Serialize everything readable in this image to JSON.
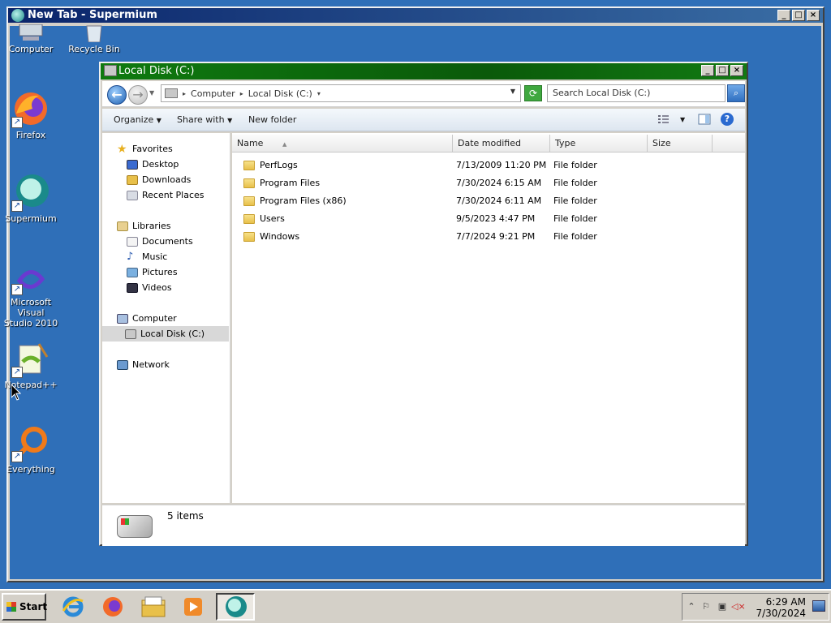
{
  "desktop": {
    "icons": [
      {
        "label": "Computer"
      },
      {
        "label": "Recycle Bin"
      },
      {
        "label": "Firefox"
      },
      {
        "label": "Supermium"
      },
      {
        "label": "Microsoft Visual Studio 2010",
        "line1": "Microsoft Visual",
        "line2": "Studio 2010"
      },
      {
        "label": "Notepad++",
        "line1": "Notepad++"
      },
      {
        "label": "Everything"
      }
    ]
  },
  "browser_window": {
    "title": "New Tab - Supermium"
  },
  "explorer": {
    "title": "Local Disk (C:)",
    "breadcrumb": [
      "Computer",
      "Local Disk (C:)"
    ],
    "search_placeholder": "Search Local Disk (C:)",
    "toolbar": {
      "organize": "Organize",
      "share_with": "Share with",
      "new_folder": "New folder"
    },
    "nav": {
      "favorites": "Favorites",
      "desktop": "Desktop",
      "downloads": "Downloads",
      "recent_places": "Recent Places",
      "libraries": "Libraries",
      "documents": "Documents",
      "music": "Music",
      "pictures": "Pictures",
      "videos": "Videos",
      "computer": "Computer",
      "local_disk": "Local Disk (C:)",
      "network": "Network"
    },
    "columns": {
      "name": "Name",
      "date_modified": "Date modified",
      "type": "Type",
      "size": "Size"
    },
    "files": [
      {
        "name": "PerfLogs",
        "date": "7/13/2009 11:20 PM",
        "type": "File folder"
      },
      {
        "name": "Program Files",
        "date": "7/30/2024 6:15 AM",
        "type": "File folder"
      },
      {
        "name": "Program Files (x86)",
        "date": "7/30/2024 6:11 AM",
        "type": "File folder"
      },
      {
        "name": "Users",
        "date": "9/5/2023 4:47 PM",
        "type": "File folder"
      },
      {
        "name": "Windows",
        "date": "7/7/2024 9:21 PM",
        "type": "File folder"
      }
    ],
    "details": {
      "items": "5 items"
    }
  },
  "taskbar": {
    "start": "Start",
    "time": "6:29 AM",
    "date": "7/30/2024"
  },
  "colors": {
    "desktop": "#2f6fb8",
    "explorer_title": "#0f7a0f",
    "browser_title": "#0a246a"
  }
}
